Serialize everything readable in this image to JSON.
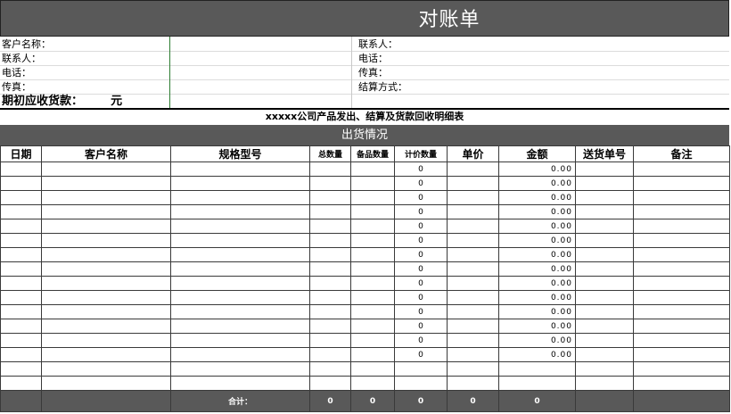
{
  "title": "对账单",
  "customer_info": {
    "left": [
      "客户名称：",
      "联系人：",
      "电话：",
      "传真："
    ],
    "right": [
      "联系人：",
      "电话：",
      "传真：",
      "结算方式："
    ]
  },
  "opening_balance": {
    "label": "期初应收货款：",
    "unit": "元"
  },
  "report_title": "xxxxx公司产品发出、结算及货款回收明细表",
  "section_title": "出货情况",
  "columns": [
    "日期",
    "客户名称",
    "规格型号",
    "总数量",
    "备品数量",
    "计价数量",
    "单价",
    "金额",
    "送货单号",
    "备注"
  ],
  "rows": [
    {
      "count": "0",
      "amount": "0.00"
    },
    {
      "count": "0",
      "amount": "0.00"
    },
    {
      "count": "0",
      "amount": "0.00"
    },
    {
      "count": "0",
      "amount": "0.00"
    },
    {
      "count": "0",
      "amount": "0.00"
    },
    {
      "count": "0",
      "amount": "0.00"
    },
    {
      "count": "0",
      "amount": "0.00"
    },
    {
      "count": "0",
      "amount": "0.00"
    },
    {
      "count": "0",
      "amount": "0.00"
    },
    {
      "count": "0",
      "amount": "0.00"
    },
    {
      "count": "0",
      "amount": "0.00"
    },
    {
      "count": "0",
      "amount": "0.00"
    },
    {
      "count": "0",
      "amount": "0.00"
    },
    {
      "count": "0",
      "amount": "0.00"
    },
    {
      "count": "",
      "amount": ""
    },
    {
      "count": "",
      "amount": ""
    }
  ],
  "totals": {
    "label": "合计：",
    "total_qty": "0",
    "spare_qty": "0",
    "priced_qty": "0",
    "unit_price": "0",
    "amount": "0"
  }
}
